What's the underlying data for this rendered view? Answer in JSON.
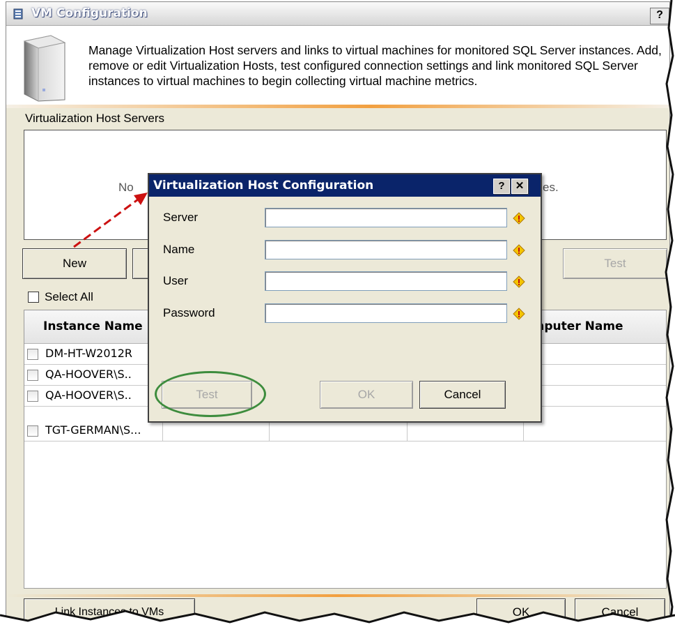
{
  "window": {
    "title": "VM Configuration",
    "help": "?",
    "description": "Manage Virtualization Host servers and links to virtual machines for monitored SQL Server instances. Add, remove or edit Virtualization Hosts, test configured connection settings and link monitored SQL Server instances to virtual machines to begin collecting virtual machine metrics."
  },
  "hosts": {
    "label": "Virtualization Host Servers",
    "empty_a": "No",
    "empty_b": "es.",
    "new_button": "New",
    "test_button": "Test"
  },
  "grid": {
    "select_all": "Select All",
    "columns": {
      "instance": "Instance Name",
      "computer": "omputer Name"
    },
    "rows": [
      {
        "name": "DM-HT-W2012R"
      },
      {
        "name": "QA-HOOVER\\S.."
      },
      {
        "name": "QA-HOOVER\\S.."
      },
      {
        "name": "TGT-GERMAN\\S..."
      }
    ]
  },
  "bottom": {
    "link_button": "Link Instances to VMs",
    "ok_button": "OK",
    "cancel_button": "Cancel"
  },
  "dialog": {
    "title": "Virtualization Host Configuration",
    "help": "?",
    "close": "✕",
    "fields": [
      {
        "label": "Server",
        "value": ""
      },
      {
        "label": "Name",
        "value": ""
      },
      {
        "label": "User",
        "value": ""
      },
      {
        "label": "Password",
        "value": ""
      }
    ],
    "test_button": "Test",
    "ok_button": "OK",
    "cancel_button": "Cancel"
  },
  "colors": {
    "dialog_title_bg": "#0a246a",
    "annotation_arrow": "#cc1111",
    "annotation_ellipse": "#3d8c3d",
    "accent_orange": "#f2a040"
  }
}
